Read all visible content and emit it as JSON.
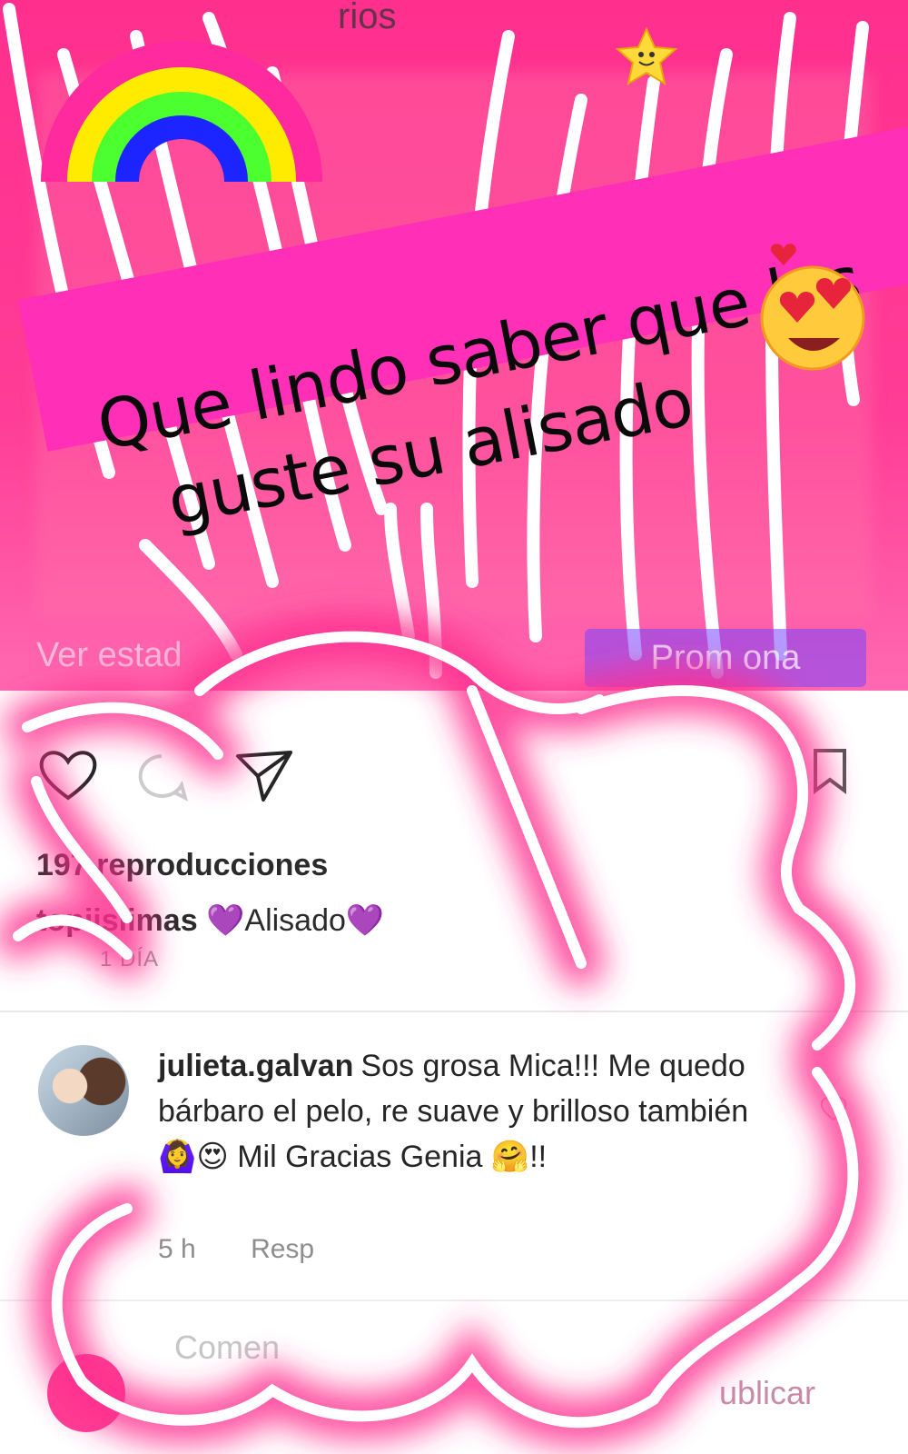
{
  "story": {
    "top_partial_text": "rios",
    "banner_line1": "Que lindo saber que les",
    "banner_line2": "guste su alisado"
  },
  "post": {
    "faded_left_text": "Ver estad",
    "promote_button": "Prom    ona",
    "views_text": "197 reproducciones",
    "caption_user": "topiisiimas",
    "caption_text": "💜Alisado💜",
    "time_ago": "1 DÍA"
  },
  "comment": {
    "user": "julieta.galvan",
    "text": "Sos grosa Mica!!! Me quedo bárbaro el pelo, re suave y brilloso también 🙆‍♀️😍 Mil Gracias Genia 🤗!!",
    "time": "5 h",
    "reply_label": "Resp"
  },
  "composer": {
    "placeholder": "Comen",
    "publish_label": "ublicar"
  },
  "colors": {
    "pink_paint": "#ff2f8e",
    "banner": "#ff2fb8",
    "rainbow": [
      "#ff2a9d",
      "#ffeb00",
      "#4cff2e",
      "#1c25ff"
    ]
  },
  "icons": [
    "rainbow-sticker-icon",
    "star-sticker-icon",
    "heart-eyes-emoji-icon",
    "heart-icon",
    "comment-icon",
    "send-icon",
    "bookmark-icon",
    "heart-small-icon"
  ]
}
